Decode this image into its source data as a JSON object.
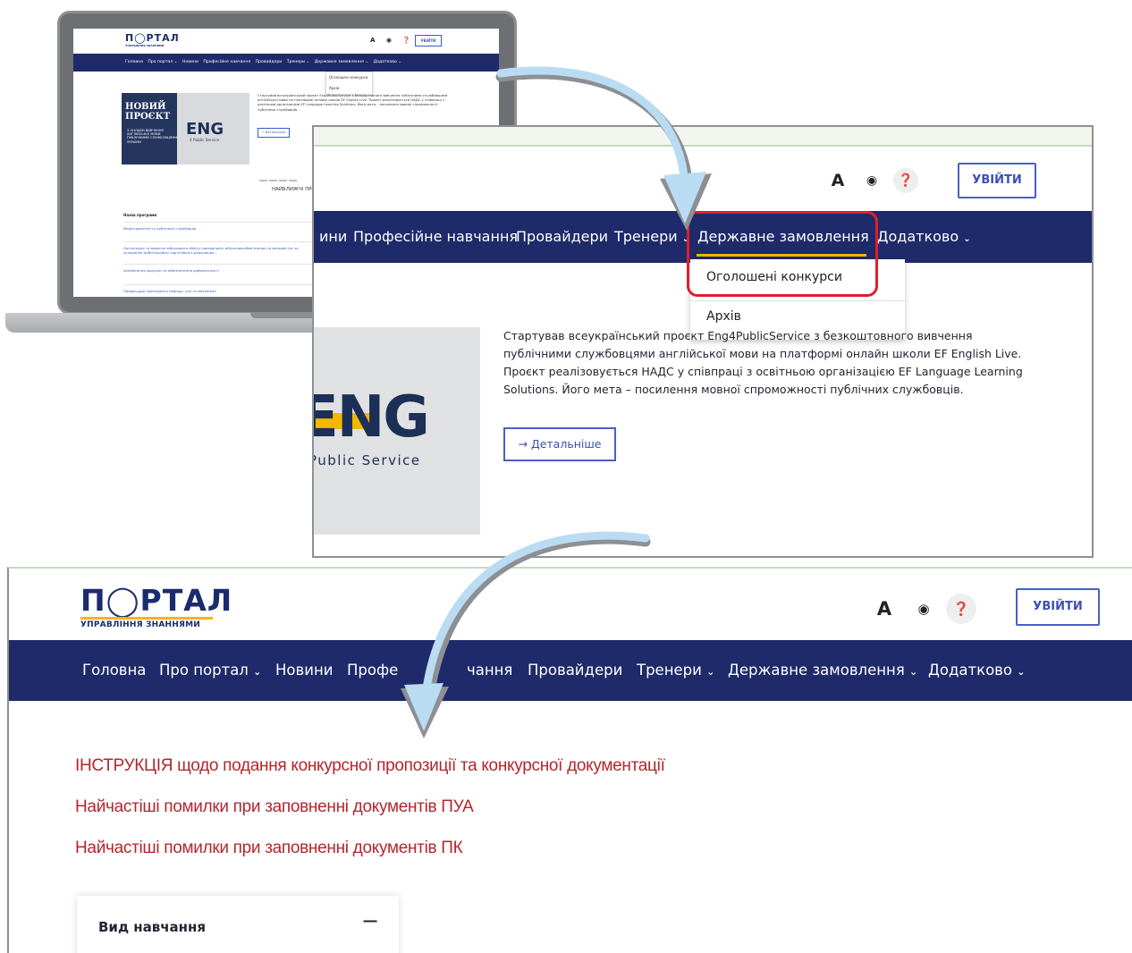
{
  "laptop": {
    "logo": "П◯РТАЛ",
    "logo_sub": "УПРАВЛІННЯ ЗНАННЯМИ",
    "tools": "A ◉ ❓",
    "login": "УВІЙТИ",
    "nav": [
      "Головна",
      "Про портал ⌄",
      "Новини",
      "Професійне навчання",
      "Провайдери",
      "Тренери ⌄",
      "Державне замовлення ⌄",
      "Додатково ⌄"
    ],
    "dropdown": [
      "Оголошені конкурси",
      "Архів"
    ],
    "hero_title": "НОВИЙ ПРОЄКТ",
    "hero_small": "З ОНЛАЙН ВИВЧЕННЯ АНГЛІЙСЬКОЇ МОВИ ПУБЛІЧНИМИ СЛУЖБОВЦЯМИ УКРАЇНИ",
    "eng": "ENG",
    "eng_sub": "4 Public Service",
    "hero_text": "Стартував всеукраїнський проєкт Eng4PublicService з безкоштовного вивчення публічними службовцями англійської мови на платформі онлайн школи EF English Live. Проєкт реалізовується НАДС у співпраці з освітньою організацією EF Language Learning Solutions. Його мета – посилення мовної спроможності публічних службовців.",
    "more": "→ Детальніше",
    "section": "НАЙБЛИЖЧІ ПРОГРАМ",
    "table_header": "Назва програми",
    "rows": [
      "Медіаграмотність публічних службовців",
      "Організація та ведення військового обліку призовників, військовозобов'язаних та резервістів, за складання мобілізаційної підготовки в державних...",
      "Запобігання корупції та забезпечення доброчесності",
      "Правосуддя перехідного періоду: цілі та механізми"
    ]
  },
  "zoom": {
    "tools": [
      "A",
      "◉",
      "❓"
    ],
    "login": "УВІЙТИ",
    "nav": [
      "ини",
      "Професійне навчання",
      "Провайдери",
      "Тренери",
      "Державне замовлення",
      "Додатково"
    ],
    "dropdown": [
      "Оголошені конкурси",
      "Архів"
    ],
    "eng": "ENG",
    "eng_sub": "Public Service",
    "hero_text": "Стартував всеукраїнський проєкт Eng4PublicService з безкоштовного вивчення публічними службовцями англійської мови на платформі онлайн школи EF English Live. Проєкт реалізовується НАДС у співпраці з освітньою організацією EF Language Learning Solutions. Його мета – посилення мовної спроможності публічних службовців.",
    "more": "→ Детальніше"
  },
  "page": {
    "logo": "П◯РТАЛ",
    "logo_sub": "УПРАВЛІННЯ ЗНАННЯМИ",
    "tools": [
      "A",
      "◉",
      "❓"
    ],
    "login": "УВІЙТИ",
    "nav": [
      "Головна",
      "Про портал",
      "Новини",
      "Профе",
      "чання",
      "Провайдери",
      "Тренери",
      "Державне замовлення",
      "Додатково"
    ],
    "links": [
      "ІНСТРУКЦІЯ щодо подання конкурсної пропозиції та конкурсної документації",
      "Найчастіші помилки при заповненні документів ПУА",
      "Найчастіші помилки при заповненні документів ПК"
    ],
    "accordion_title": "Вид навчання",
    "accordion_toggle": "−"
  },
  "colors": {
    "nav_bg": "#1e2a6a",
    "accent_yellow": "#f2b700",
    "link_red": "#b3262b",
    "highlight_red": "#e21d2b",
    "button_blue": "#3a4fb6",
    "arrow_blue": "#b9dcf2"
  }
}
